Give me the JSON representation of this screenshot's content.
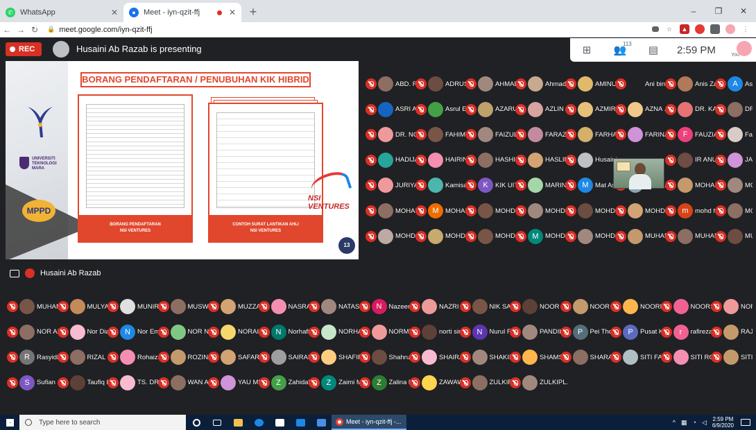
{
  "browser": {
    "tabs": [
      {
        "title": "WhatsApp",
        "favicon_color": "#25d366",
        "active": false
      },
      {
        "title": "Meet - iyn-qzit-ffj",
        "favicon_color": "#1a73e8",
        "active": true
      }
    ],
    "new_tab": "+",
    "url": "meet.google.com/iyn-qzit-ffj",
    "window_controls": [
      "–",
      "❐",
      "✕"
    ]
  },
  "meet": {
    "rec_label": "REC",
    "presenting_text": "Husaini Ab Razab is presenting",
    "participant_count": "113",
    "time": "2:59 PM",
    "you_label": "You",
    "presenter_name": "Husaini Ab Razab"
  },
  "slide": {
    "title": "BORANG PENDAFTARAN / PENUBUHAN KIK HIBRID",
    "panel1_label": "BORANG PENDAFTARAN\nNSI VENTURES",
    "panel2_label": "CONTOH SURAT LANTIKAN AHLI\nNSI VENTURES",
    "uitm_text": "UNIVERSITI TEKNOLOGI MARA",
    "mppd": "MPPD",
    "brand": "NSI VENTURES",
    "page_number": "13"
  },
  "participants": [
    {
      "name": "ABD. RA...",
      "initial": "",
      "color": "#8d6e63"
    },
    {
      "name": "ADRUS...",
      "initial": "",
      "color": "#6d4c41"
    },
    {
      "name": "AHMAD ...",
      "initial": "",
      "color": "#a1887f"
    },
    {
      "name": "Ahmad ...",
      "initial": "",
      "color": "#c6a98f"
    },
    {
      "name": "AMINUR...",
      "initial": "",
      "color": "#e0b96b"
    },
    {
      "name": "Ani binti...",
      "initial": "",
      "color": "#202124"
    },
    {
      "name": "Anis Za...",
      "initial": "",
      "color": "#b07a5a"
    },
    {
      "name": "Asilah A...",
      "initial": "A",
      "color": "#1e88e5"
    },
    {
      "name": "ASRI AB...",
      "initial": "",
      "color": "#1565c0"
    },
    {
      "name": "Asrul Eff...",
      "initial": "",
      "color": "#43a047"
    },
    {
      "name": "AZARUD...",
      "initial": "",
      "color": "#c0a16b"
    },
    {
      "name": "AZLIN A...",
      "initial": "",
      "color": "#d7a4a0"
    },
    {
      "name": "AZMIRA...",
      "initial": "",
      "color": "#e8c07a"
    },
    {
      "name": "AZNA ...",
      "initial": "",
      "color": "#f0c98a"
    },
    {
      "name": "DR. KAR...",
      "initial": "",
      "color": "#e57373"
    },
    {
      "name": "DR. MO...",
      "initial": "",
      "color": "#8d6e63"
    },
    {
      "name": "DR. NOR...",
      "initial": "",
      "color": "#ef9a9a"
    },
    {
      "name": "FAHIMI ...",
      "initial": "",
      "color": "#795548"
    },
    {
      "name": "FAIZUL ...",
      "initial": "",
      "color": "#a1887f"
    },
    {
      "name": "FARAZIL...",
      "initial": "",
      "color": "#c48b9f"
    },
    {
      "name": "FARHAN...",
      "initial": "",
      "color": "#d4b06a"
    },
    {
      "name": "FARINA ...",
      "initial": "",
      "color": "#ce93d8"
    },
    {
      "name": "FAUZIA...",
      "initial": "F",
      "color": "#ec407a"
    },
    {
      "name": "Fazhana...",
      "initial": "",
      "color": "#d7ccc8"
    },
    {
      "name": "HADIJA...",
      "initial": "",
      "color": "#26a69a"
    },
    {
      "name": "HAIRIN...",
      "initial": "",
      "color": "#f48fb1"
    },
    {
      "name": "HASHIM...",
      "initial": "",
      "color": "#8d6e63"
    },
    {
      "name": "HASLIN...",
      "initial": "",
      "color": "#d4a373"
    },
    {
      "name": "Husaini ...",
      "initial": "",
      "color": "#bdc1c6"
    },
    {
      "name": "",
      "initial": "",
      "color": "#202124"
    },
    {
      "name": "IR ANU...",
      "initial": "",
      "color": "#6d4c41"
    },
    {
      "name": "JAZIRA...",
      "initial": "",
      "color": "#ce93d8"
    },
    {
      "name": "JURIYA...",
      "initial": "",
      "color": "#ef9a9a"
    },
    {
      "name": "Kamisa...",
      "initial": "",
      "color": "#4db6ac"
    },
    {
      "name": "KIK UITM",
      "initial": "K",
      "color": "#7e57c2"
    },
    {
      "name": "MARINA...",
      "initial": "",
      "color": "#a5d6a7"
    },
    {
      "name": "Mat Asri",
      "initial": "M",
      "color": "#1e88e5"
    },
    {
      "name": "Megat A...",
      "initial": "",
      "color": "#90a4ae"
    },
    {
      "name": "MOHAM...",
      "initial": "",
      "color": "#c49a6c"
    },
    {
      "name": "MOHAM...",
      "initial": "",
      "color": "#a1887f"
    },
    {
      "name": "MOHAM...",
      "initial": "",
      "color": "#8d6e63"
    },
    {
      "name": "MOHAM...",
      "initial": "M",
      "color": "#ef6c00"
    },
    {
      "name": "MOHD A...",
      "initial": "",
      "color": "#795548"
    },
    {
      "name": "MOHD A...",
      "initial": "",
      "color": "#a1887f"
    },
    {
      "name": "MOHD F...",
      "initial": "",
      "color": "#6d4c41"
    },
    {
      "name": "MOHD ...",
      "initial": "",
      "color": "#d4a373"
    },
    {
      "name": "mohd h...",
      "initial": "m",
      "color": "#d84315"
    },
    {
      "name": "MOHD ...",
      "initial": "",
      "color": "#8d6e63"
    },
    {
      "name": "MOHD I...",
      "initial": "",
      "color": "#bcaaa4"
    },
    {
      "name": "MOHD S...",
      "initial": "",
      "color": "#c8a96e"
    },
    {
      "name": "MOHD S...",
      "initial": "",
      "color": "#795548"
    },
    {
      "name": "MOHD S...",
      "initial": "M",
      "color": "#00897b"
    },
    {
      "name": "MOHD Z...",
      "initial": "",
      "color": "#a1887f"
    },
    {
      "name": "MUHAM...",
      "initial": "",
      "color": "#c49a6c"
    },
    {
      "name": "MUHAM...",
      "initial": "",
      "color": "#8d6e63"
    },
    {
      "name": "MUHAM...",
      "initial": "",
      "color": "#6d4c41"
    },
    {
      "name": "MUHAM...",
      "initial": "",
      "color": "#795548"
    },
    {
      "name": "MULYAZ...",
      "initial": "",
      "color": "#c48b5a"
    },
    {
      "name": "MUNIRA...",
      "initial": "",
      "color": "#e0e0e0"
    },
    {
      "name": "MUSWA...",
      "initial": "",
      "color": "#8d6e63"
    },
    {
      "name": "MUZZA...",
      "initial": "",
      "color": "#d4a373"
    },
    {
      "name": "NASRA...",
      "initial": "",
      "color": "#f48fb1"
    },
    {
      "name": "NATASH...",
      "initial": "",
      "color": "#a1887f"
    },
    {
      "name": "Nazeem...",
      "initial": "N",
      "color": "#d81b60"
    },
    {
      "name": "NAZRI J...",
      "initial": "",
      "color": "#ef9a9a"
    },
    {
      "name": "NIK SAI...",
      "initial": "",
      "color": "#795548"
    },
    {
      "name": "NOOR A...",
      "initial": "",
      "color": "#5d4037"
    },
    {
      "name": "NOOR A...",
      "initial": "",
      "color": "#c49a6c"
    },
    {
      "name": "NOORIZ...",
      "initial": "",
      "color": "#ffb74d"
    },
    {
      "name": "NOORS...",
      "initial": "",
      "color": "#f06292"
    },
    {
      "name": "NOR AI...",
      "initial": "",
      "color": "#ef9a9a"
    },
    {
      "name": "NOR AZI...",
      "initial": "",
      "color": "#8d6e63"
    },
    {
      "name": "Nor Dia...",
      "initial": "",
      "color": "#f8bbd0"
    },
    {
      "name": "Nor Emi...",
      "initial": "N",
      "color": "#1e88e5"
    },
    {
      "name": "NOR NA...",
      "initial": "",
      "color": "#81c784"
    },
    {
      "name": "NORAIN...",
      "initial": "",
      "color": "#f5d76e"
    },
    {
      "name": "Norhafiz...",
      "initial": "N",
      "color": "#00796b"
    },
    {
      "name": "NORHA...",
      "initial": "",
      "color": "#c8e6c9"
    },
    {
      "name": "NORME ...",
      "initial": "",
      "color": "#ef9a9a"
    },
    {
      "name": "norti sirin",
      "initial": "",
      "color": "#5d4037"
    },
    {
      "name": "Nurul Fa...",
      "initial": "N",
      "color": "#5e35b1"
    },
    {
      "name": "PANDIK...",
      "initial": "",
      "color": "#a1887f"
    },
    {
      "name": "Pei Tho...",
      "initial": "P",
      "color": "#546e7a"
    },
    {
      "name": "Pusat K...",
      "initial": "P",
      "color": "#5c6bc0"
    },
    {
      "name": "rafireza",
      "initial": "r",
      "color": "#f06292"
    },
    {
      "name": "RAJA N...",
      "initial": "",
      "color": "#c49a6c"
    },
    {
      "name": "Rasyidi ...",
      "initial": "R",
      "color": "#757575"
    },
    {
      "name": "RIZAL M...",
      "initial": "",
      "color": "#8d6e63"
    },
    {
      "name": "Rohaiza...",
      "initial": "",
      "color": "#f48fb1"
    },
    {
      "name": "ROZINA...",
      "initial": "",
      "color": "#c49a6c"
    },
    {
      "name": "SAFARI ...",
      "initial": "",
      "color": "#d4a373"
    },
    {
      "name": "SAIRAH ...",
      "initial": "",
      "color": "#9e9e9e"
    },
    {
      "name": "SHAFIR...",
      "initial": "",
      "color": "#ffcc80"
    },
    {
      "name": "Shahrul ...",
      "initial": "",
      "color": "#6d4c41"
    },
    {
      "name": "SHAIRA ...",
      "initial": "",
      "color": "#f8bbd0"
    },
    {
      "name": "SHAKIRI...",
      "initial": "",
      "color": "#a1887f"
    },
    {
      "name": "SHAMS...",
      "initial": "",
      "color": "#ffb74d"
    },
    {
      "name": "SHARAF...",
      "initial": "",
      "color": "#8d6e63"
    },
    {
      "name": "SITI FAI...",
      "initial": "",
      "color": "#b0bec5"
    },
    {
      "name": "SITI RO...",
      "initial": "",
      "color": "#f48fb1"
    },
    {
      "name": "SITI SA...",
      "initial": "",
      "color": "#c49a6c"
    },
    {
      "name": "Sufian ...",
      "initial": "S",
      "color": "#7e57c2"
    },
    {
      "name": "Taufiq H...",
      "initial": "",
      "color": "#5d4037"
    },
    {
      "name": "TS. DR. ...",
      "initial": "",
      "color": "#f8bbd0"
    },
    {
      "name": "WAN AS...",
      "initial": "",
      "color": "#8d6e63"
    },
    {
      "name": "YAU ME...",
      "initial": "",
      "color": "#ce93d8"
    },
    {
      "name": "Zahidah ...",
      "initial": "Z",
      "color": "#43a047"
    },
    {
      "name": "Zaimi M...",
      "initial": "Z",
      "color": "#00897b"
    },
    {
      "name": "Zalina bi...",
      "initial": "Z",
      "color": "#2e7d32"
    },
    {
      "name": "ZAWAW...",
      "initial": "",
      "color": "#ffd54f"
    },
    {
      "name": "ZULKIFL...",
      "initial": "",
      "color": "#8d6e63"
    },
    {
      "name": "ZULKIPL...",
      "initial": "",
      "color": "#a1887f"
    }
  ],
  "taskbar": {
    "search_placeholder": "Type here to search",
    "meet_task": "Meet - iyn-qzit-ffj -...",
    "clock_time": "2:59 PM",
    "clock_date": "6/9/2020"
  },
  "colors": {
    "accent_red": "#d93025",
    "slide_orange": "#e1472d",
    "meet_bg": "#202124"
  }
}
